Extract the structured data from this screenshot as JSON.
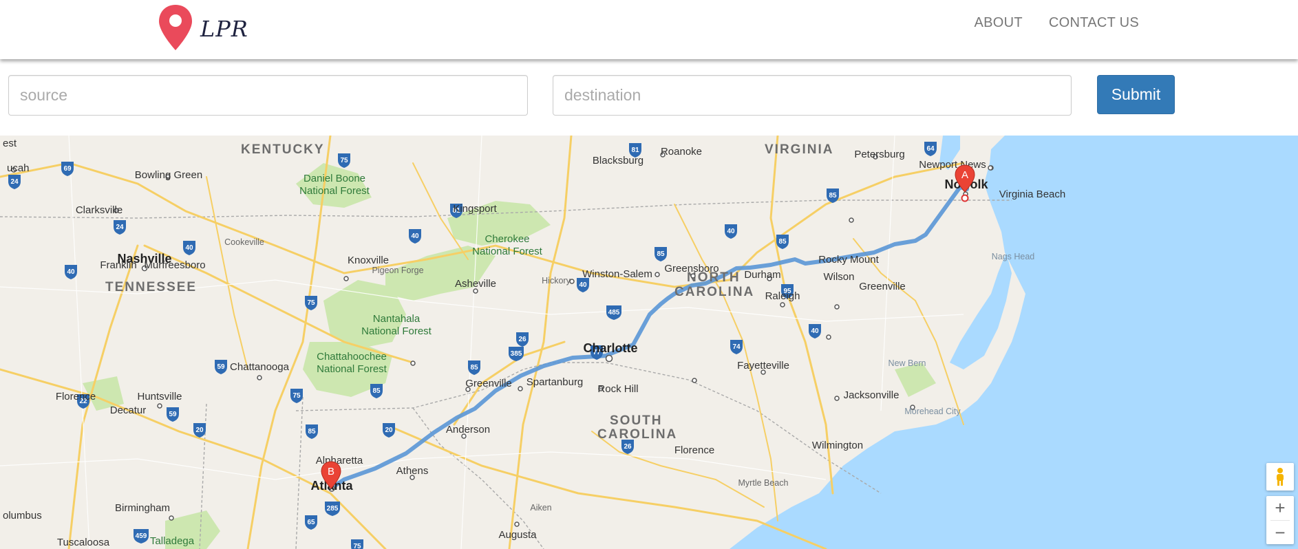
{
  "brand": {
    "name": "LPR"
  },
  "nav": {
    "about": "ABOUT",
    "contact": "CONTACT US"
  },
  "form": {
    "source_placeholder": "source",
    "destination_placeholder": "destination",
    "submit_label": "Submit"
  },
  "map": {
    "markers": {
      "a": "A",
      "b": "B"
    },
    "states": {
      "kentucky": "KENTUCKY",
      "virginia": "VIRGINIA",
      "tennessee": "TENNESSEE",
      "north_carolina_1": "NORTH",
      "north_carolina_2": "CAROLINA",
      "south_carolina_1": "SOUTH",
      "south_carolina_2": "CAROLINA"
    },
    "cities": {
      "nashville": "Nashville",
      "charlotte": "Charlotte",
      "atlanta": "Atlanta",
      "knoxville": "Knoxville",
      "asheville": "Asheville",
      "greensboro": "Greensboro",
      "winston_salem": "Winston-Salem",
      "durham": "Durham",
      "raleigh": "Raleigh",
      "greenville_sc": "Greenville",
      "spartanburg": "Spartanburg",
      "rock_hill": "Rock Hill",
      "anderson": "Anderson",
      "athens": "Athens",
      "augusta": "Augusta",
      "chattanooga": "Chattanooga",
      "huntsville": "Huntsville",
      "birmingham": "Birmingham",
      "tuscaloosa": "Tuscaloosa",
      "decatur": "Decatur",
      "florence_al": "Florence",
      "clarksville": "Clarksville",
      "bowling_green": "Bowling Green",
      "franklin": "Franklin",
      "murfreesboro": "Murfreesboro",
      "kingsport": "Kingsport",
      "roanoke": "Roanoke",
      "blacksburg": "Blacksburg",
      "petersburg": "Petersburg",
      "newport_news": "Newport News",
      "norfolk": "Norfolk",
      "virginia_beach": "Virginia Beach",
      "rocky_mount": "Rocky Mount",
      "wilson": "Wilson",
      "greenville_nc": "Greenville",
      "fayetteville": "Fayetteville",
      "jacksonville": "Jacksonville",
      "wilmington": "Wilmington",
      "florence_sc": "Florence",
      "myrtle_beach": "Myrtle Beach",
      "hickory": "Hickory",
      "alpharetta": "Alpharetta",
      "paducah": "ucah",
      "est": "est",
      "columbus": "olumbus"
    },
    "small": {
      "cookeville": "Cookeville",
      "pigeon_forge": "Pigeon Forge",
      "new_bern": "New Bern",
      "morehead_city": "Morehead City",
      "aiken": "Aiken",
      "nags_head": "Nags Head"
    },
    "forests": {
      "daniel_boone_1": "Daniel Boone",
      "daniel_boone_2": "National Forest",
      "cherokee_1": "Cherokee",
      "cherokee_2": "National Forest",
      "nantahala_1": "Nantahala",
      "nantahala_2": "National Forest",
      "chattahoochee_1": "Chattahoochee",
      "chattahoochee_2": "National Forest",
      "talladega": "Talladega"
    },
    "shields": {
      "i69": "69",
      "i24a": "24",
      "i24b": "24",
      "i40a": "40",
      "i40b": "40",
      "i40c": "40",
      "i40d": "40",
      "i40e": "40",
      "i40f": "40",
      "i75a": "75",
      "i75b": "75",
      "i75c": "75",
      "i81a": "81",
      "i81b": "81",
      "i64": "64",
      "i85a": "85",
      "i85b": "85",
      "i85c": "85",
      "i85d": "85",
      "i85e": "85",
      "i85f": "85",
      "i485": "485",
      "i26a": "26",
      "i26b": "26",
      "i385": "385",
      "i77": "77",
      "i95": "95",
      "i74": "74",
      "i59a": "59",
      "i59b": "59",
      "i22": "22",
      "i20a": "20",
      "i20b": "20",
      "i285": "285",
      "i459": "459",
      "i65": "65",
      "i75d": "75"
    },
    "controls": {
      "zoom_in": "+",
      "zoom_out": "−"
    }
  }
}
